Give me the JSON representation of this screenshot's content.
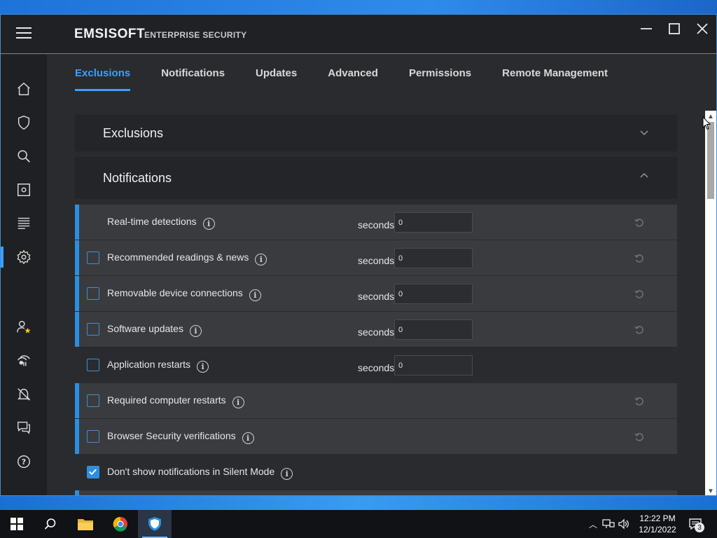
{
  "window": {
    "brand": "EMSISOFT",
    "product": "ENTERPRISE SECURITY"
  },
  "tabs": [
    {
      "label": "Exclusions",
      "active": true
    },
    {
      "label": "Notifications",
      "active": false
    },
    {
      "label": "Updates",
      "active": false
    },
    {
      "label": "Advanced",
      "active": false
    },
    {
      "label": "Permissions",
      "active": false
    },
    {
      "label": "Remote Management",
      "active": false
    }
  ],
  "sections": {
    "exclusions_title": "Exclusions",
    "notifications_title": "Notifications"
  },
  "rows": [
    {
      "label": "Real-time detections",
      "seconds_label": "seconds",
      "value": "0"
    },
    {
      "label": "Recommended readings & news",
      "seconds_label": "seconds",
      "value": "0"
    },
    {
      "label": "Removable device connections",
      "seconds_label": "seconds",
      "value": "0"
    },
    {
      "label": "Software updates",
      "seconds_label": "seconds",
      "value": "0"
    },
    {
      "label": "Application restarts",
      "seconds_label": "seconds",
      "value": "0"
    },
    {
      "label": "Required computer restarts"
    },
    {
      "label": "Browser Security verifications"
    },
    {
      "label": "Don't show notifications in Silent Mode"
    }
  ],
  "taskbar": {
    "time": "12:22 PM",
    "date": "12/1/2022",
    "notification_count": "3"
  },
  "colors": {
    "accent": "#3aa0ff",
    "row_bg": "#3a3b3e",
    "window_bg": "#2a2b2e"
  },
  "icons": {
    "nav": [
      "home-icon",
      "shield-icon",
      "search-icon",
      "quarantine-icon",
      "logs-icon",
      "gear-icon",
      "user-star-icon",
      "remote-icon",
      "bell-off-icon",
      "chat-icon",
      "help-icon"
    ],
    "taskbar": [
      "windows-start-icon",
      "search-icon",
      "file-explorer-icon",
      "chrome-icon",
      "emsisoft-icon"
    ]
  }
}
